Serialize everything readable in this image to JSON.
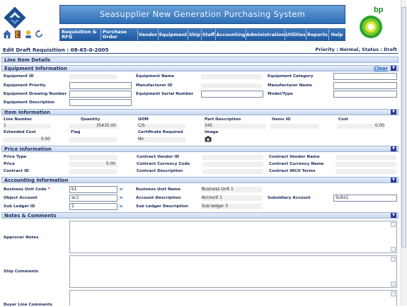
{
  "app": {
    "title": "Seasupplier New Generation Purchasing System",
    "brand": "bp"
  },
  "nav": [
    {
      "label": "Requisition & RFQ",
      "w": 58
    },
    {
      "label": "Purchase Order",
      "w": 52
    },
    {
      "label": "Vendor",
      "w": 29
    },
    {
      "label": "Equipment",
      "w": 42
    },
    {
      "label": "Ship",
      "w": 19
    },
    {
      "label": "Staff",
      "w": 20
    },
    {
      "label": "Accounting",
      "w": 43
    },
    {
      "label": "Administration",
      "w": 55
    },
    {
      "label": "Utilities",
      "w": 30
    },
    {
      "label": "Reports",
      "w": 32
    },
    {
      "label": "Help",
      "w": 20
    }
  ],
  "page": {
    "title": "Edit Draft Requisition : 08-65-0-2005",
    "status": "Priority : Normal, Status : Draft"
  },
  "line_item": {
    "title": "Line Item Details"
  },
  "equipment": {
    "title": "Equipment Information",
    "clear": "Clear",
    "labels": {
      "equipment_id": "Equipment ID",
      "equipment_name": "Equipment Name",
      "equipment_category": "Equipment Category",
      "equipment_priority": "Equipment Priority",
      "manufacturer_id": "Manufacturer ID",
      "manufacturer_name": "Manufacturer Name",
      "drawing_number": "Equipment Drawing Number",
      "serial_number": "Equipment Serial Number",
      "model_type": "Model/Type",
      "description": "Equipment Description"
    }
  },
  "item": {
    "title": "Item Information",
    "labels": {
      "line_number": "Line Number",
      "quantity": "Quantity",
      "uom": "UOM",
      "part_description": "Part Description",
      "items_id": "Items ID",
      "cost": "Cost",
      "extended_cost": "Extended Cost",
      "flag": "Flag",
      "certificate_required": "Certificate Required",
      "image": "Image"
    },
    "values": {
      "line_number": "1",
      "quantity": "35435.00",
      "uom": "C/S",
      "part_description": "345",
      "cost": "0.00",
      "extended_cost": "0.00",
      "certificate_required": "No"
    }
  },
  "price": {
    "title": "Price Information",
    "labels": {
      "price_type": "Price Type",
      "contract_vendor_id": "Contract Vendor ID",
      "contract_vendor_name": "Contract Vendor Name",
      "price": "Price",
      "contract_currency_code": "Contract Currency Code",
      "contract_currency_name": "Contract Currency Name",
      "contract_id": "Contract ID",
      "contract_description": "Contract Description",
      "contract_inco_terms": "Contract INCO Terms"
    },
    "values": {
      "price": "0.00"
    }
  },
  "accounting": {
    "title": "Accounting Information",
    "labels": {
      "business_unit_code": "Business Unit Code",
      "required_mark": "*",
      "business_unit_name": "Business Unit Name",
      "object_account": "Object Account",
      "account_description": "Account Description",
      "subsidiary_account": "Subsidiary Account",
      "sub_ledger_id": "Sub Ledger ID",
      "sub_ledger_description": "Sub Ledger Description"
    },
    "values": {
      "business_unit_code": "b1",
      "business_unit_name": "Business Unit 1",
      "object_account": "ac1",
      "account_description": "Account 1",
      "subsidiary_account": "Subs1",
      "sub_ledger_id": "1",
      "sub_ledger_description": "Sub ledger 3"
    }
  },
  "notes": {
    "title": "Notes & Comments",
    "labels": {
      "approver_notes": "Approver Notes",
      "ship_comments": "Ship Comments",
      "buyer_line_comments": "Buyer Line Comments"
    }
  }
}
